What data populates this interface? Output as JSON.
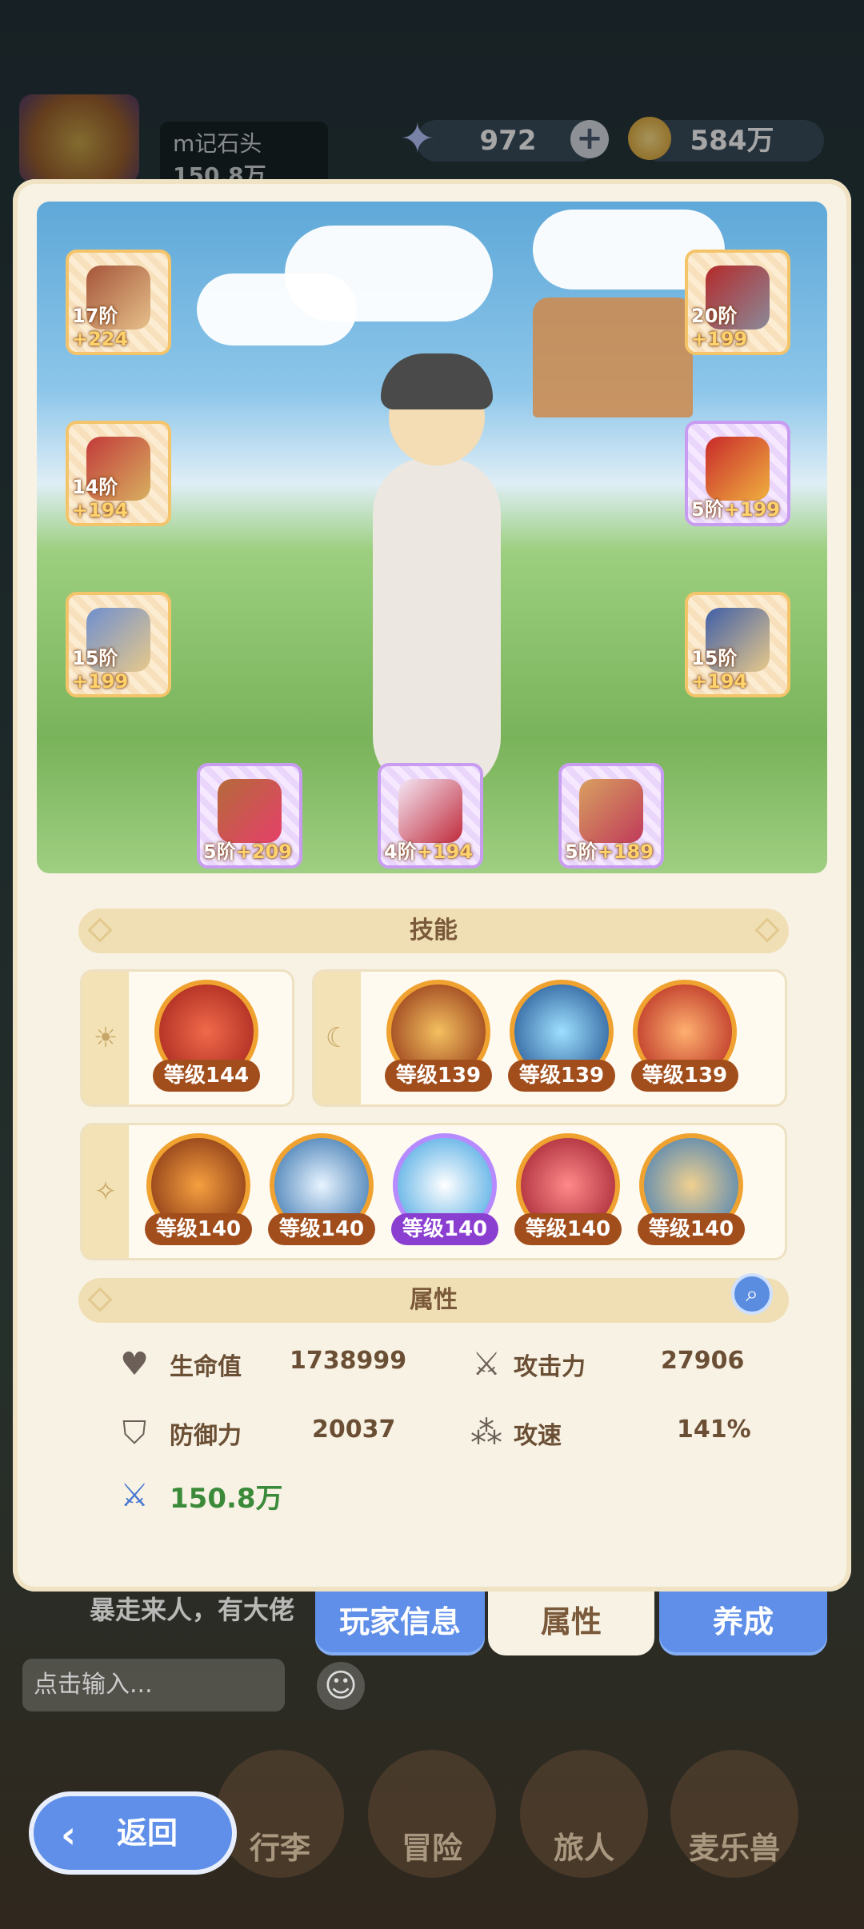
{
  "player": {
    "name": "m记石头",
    "power": "150.8万"
  },
  "resources": {
    "gems": "972",
    "gold": "584万"
  },
  "equipment": [
    {
      "name": "bow",
      "tier": "17阶",
      "bonus": "+224"
    },
    {
      "name": "helmet",
      "tier": "20阶",
      "bonus": "+199"
    },
    {
      "name": "chest-armor",
      "tier": "14阶",
      "bonus": "+194"
    },
    {
      "name": "gloves",
      "tier": "5阶",
      "bonus": "+199"
    },
    {
      "name": "leg-armor",
      "tier": "15阶",
      "bonus": "+199"
    },
    {
      "name": "boots",
      "tier": "15阶",
      "bonus": "+194"
    },
    {
      "name": "ring",
      "tier": "5阶",
      "bonus": "+209"
    },
    {
      "name": "necklace",
      "tier": "4阶",
      "bonus": "+194"
    },
    {
      "name": "charm",
      "tier": "5阶",
      "bonus": "+189"
    }
  ],
  "skills": {
    "title": "技能",
    "sun": [
      "等级144"
    ],
    "moon": [
      "等级139",
      "等级139",
      "等级139"
    ],
    "star": [
      "等级140",
      "等级140",
      "等级140",
      "等级140",
      "等级140"
    ]
  },
  "attributes": {
    "title": "属性",
    "hp_label": "生命值",
    "hp": "1738999",
    "atk_label": "攻击力",
    "atk": "27906",
    "def_label": "防御力",
    "def": "20037",
    "spd_label": "攻速",
    "spd": "141%",
    "power": "150.8万"
  },
  "tabs": [
    "玩家信息",
    "属性",
    "养成"
  ],
  "chat": {
    "message": "暴走来人，有大佬",
    "placeholder": "点击输入..."
  },
  "nav": [
    "行李",
    "冒险",
    "旅人",
    "麦乐兽"
  ],
  "back_label": "返回",
  "colors": {
    "accent_blue": "#5f8fe8",
    "panel_cream": "#f8f2e4",
    "skill_badge": "#a24e1c",
    "green_power": "#3a8a3a"
  }
}
